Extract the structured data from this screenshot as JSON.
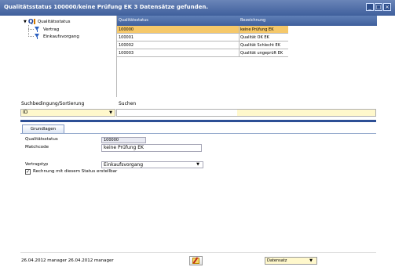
{
  "window": {
    "title": "Qualitätsstatus 100000/keine Prüfung EK   3 Datensätze gefunden.",
    "controls": {
      "minimize": "_",
      "maximize": "□",
      "close": "×"
    }
  },
  "tree": {
    "root": {
      "label": "Qualitätsstatus",
      "icon": "quality-status-icon"
    },
    "children": [
      {
        "label": "Vertrag",
        "icon": "filter-icon"
      },
      {
        "label": "Einkaufsvorgang",
        "icon": "filter-icon"
      }
    ]
  },
  "grid": {
    "headers": [
      "Qualitätsstatus",
      "Bezeichnung"
    ],
    "rows": [
      {
        "code": "100000",
        "name": "keine Prüfung EK",
        "selected": true
      },
      {
        "code": "100001",
        "name": "Qualität OK EK",
        "selected": false
      },
      {
        "code": "100002",
        "name": "Qualität Schlecht EK",
        "selected": false
      },
      {
        "code": "100003",
        "name": "Qualität ungeprüft EK",
        "selected": false
      }
    ]
  },
  "search": {
    "criteria_label": "Suchbedingung/Sortierung",
    "criteria_value": "ID",
    "search_label": "Suchen",
    "search_value": ""
  },
  "tabs": [
    {
      "label": "Grundlagen",
      "active": true
    }
  ],
  "form": {
    "quality_status_label": "Qualitätsstatus",
    "quality_status_value": "100000",
    "matchcode_label": "Matchcode",
    "matchcode_value": "keine Prüfung EK",
    "contract_type_label": "Vertragstyp",
    "contract_type_value": "Einkaufsvorgang",
    "invoice_checkbox_label": "Rechnung mit diesem Status erstellbar",
    "invoice_checkbox_checked": true,
    "checkmark": "✓"
  },
  "footer": {
    "info": "26.04.2012 manager  26.04.2012 manager",
    "dataset_select": "Datensatz"
  },
  "colors": {
    "titlebar": "#3f5f9c",
    "selected_row": "#f5c86a",
    "required_field": "#fff8cc",
    "divider": "#2d4f95"
  }
}
